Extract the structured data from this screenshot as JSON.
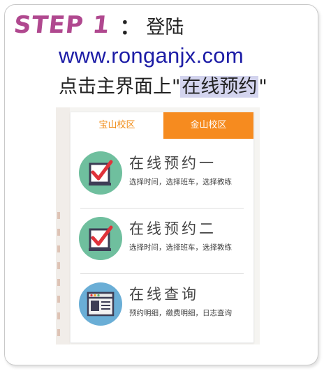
{
  "step": {
    "label": "STEP 1",
    "colon": "：",
    "title": "登陆"
  },
  "url": "www.ronganjx.com",
  "instruction": {
    "prefix": "点击主界面上\"",
    "highlight": "在线预约",
    "suffix": "\""
  },
  "tabs": [
    {
      "label": "宝山校区",
      "active": true
    },
    {
      "label": "金山校区",
      "active": false
    }
  ],
  "menu": [
    {
      "title": "在线预约一",
      "subtitle": "选择时间，选择班车，选择教练",
      "icon": "checkbox-icon"
    },
    {
      "title": "在线预约二",
      "subtitle": "选择时间，选择班车，选择教练",
      "icon": "checkbox-icon"
    },
    {
      "title": "在线查询",
      "subtitle": "预约明细，缴费明细，日志查询",
      "icon": "browser-window-icon"
    }
  ],
  "colors": {
    "step": "#b0488f",
    "url": "#1c1ca6",
    "highlight": "#d3d4ee",
    "tab_active_text": "#f08a12",
    "tab_orange": "#f68b1f",
    "icon_green": "#6fbf9e",
    "icon_blue": "#6aaed6"
  }
}
